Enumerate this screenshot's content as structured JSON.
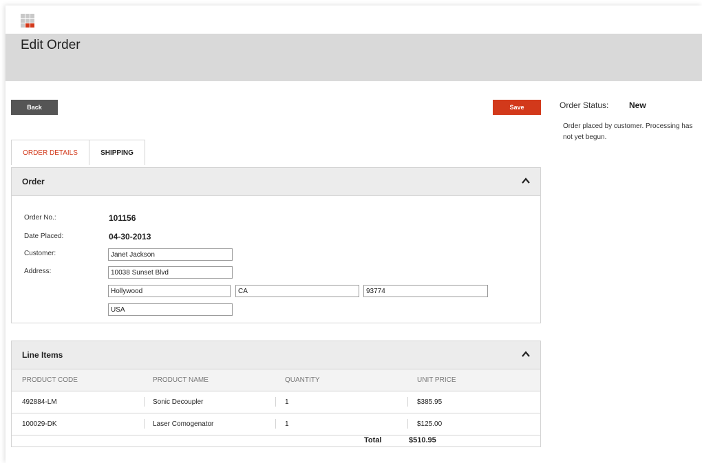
{
  "header": {
    "title": "Edit Order"
  },
  "toolbar": {
    "back_label": "Back",
    "save_label": "Save"
  },
  "status": {
    "label": "Order Status:",
    "value": "New",
    "description": "Order placed by customer. Processing has not yet begun."
  },
  "tabs": [
    {
      "label": "ORDER DETAILS",
      "active": true
    },
    {
      "label": "SHIPPING",
      "active": false
    }
  ],
  "order": {
    "title": "Order",
    "order_no_label": "Order No.:",
    "order_no": "101156",
    "date_label": "Date Placed:",
    "date": "04-30-2013",
    "customer_label": "Customer:",
    "customer": "Janet Jackson",
    "address_label": "Address:",
    "street": "10038 Sunset Blvd",
    "city": "Hollywood",
    "state": "CA",
    "zip": "93774",
    "country": "USA"
  },
  "line_items": {
    "title": "Line Items",
    "columns": [
      "PRODUCT CODE",
      "PRODUCT NAME",
      "QUANTITY",
      "UNIT PRICE"
    ],
    "rows": [
      [
        "492884-LM",
        "Sonic Decoupler",
        "1",
        "$385.95"
      ],
      [
        "100029-DK",
        "Laser Comogenator",
        "1",
        "$125.00"
      ]
    ],
    "total_label": "Total",
    "total_value": "$510.95"
  },
  "colors": {
    "accent": "#d2391b",
    "back_button": "#555555",
    "band": "#d9d9d9"
  },
  "icons": {
    "logo": "grid-logo-icon",
    "collapse": "chevron-up-icon"
  }
}
